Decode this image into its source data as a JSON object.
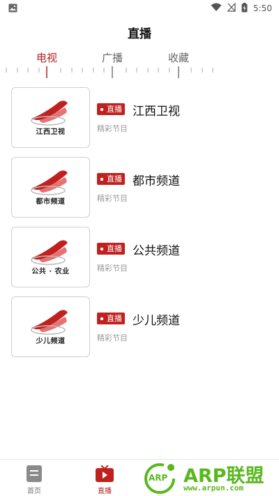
{
  "status_bar": {
    "time": "5:50",
    "icons": [
      "image-icon",
      "wifi-icon",
      "no-signal-icon",
      "battery-charging-icon"
    ]
  },
  "header": {
    "title": "直播"
  },
  "tabs": [
    {
      "label": "电视",
      "active": true
    },
    {
      "label": "广播",
      "active": false
    },
    {
      "label": "收藏",
      "active": false
    }
  ],
  "channels": [
    {
      "badge": "直播",
      "name": "江西卫视",
      "program": "精彩节目",
      "thumb_caption": "江西卫视"
    },
    {
      "badge": "直播",
      "name": "都市频道",
      "program": "精彩节目",
      "thumb_caption": "都市频道"
    },
    {
      "badge": "直播",
      "name": "公共频道",
      "program": "精彩节目",
      "thumb_caption": "公共 · 农业"
    },
    {
      "badge": "直播",
      "name": "少儿频道",
      "program": "精彩节目",
      "thumb_caption": "少儿频道"
    }
  ],
  "bottom_nav": [
    {
      "label": "首页",
      "icon": "home-doc-icon",
      "active": false
    },
    {
      "label": "直播",
      "icon": "tv-play-icon",
      "active": true
    }
  ],
  "watermark": {
    "text": "ARP联盟",
    "url": "www.arpun.com",
    "badge": "ARP"
  },
  "colors": {
    "accent": "#b21e1e",
    "badge_bg": "#c0211f",
    "muted": "#9a9a9a",
    "watermark": "#59b81d"
  }
}
